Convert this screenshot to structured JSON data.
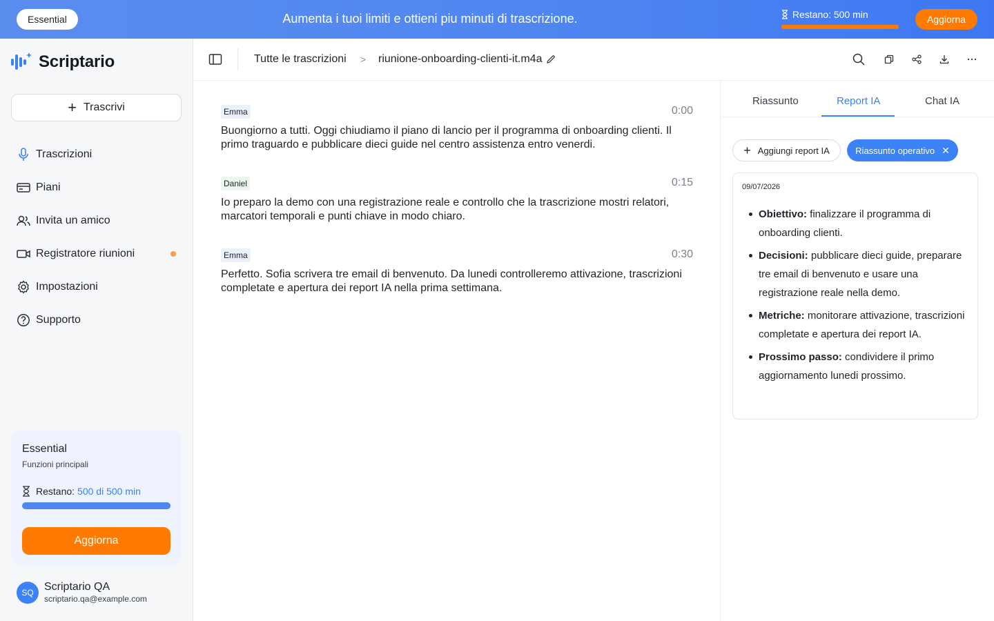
{
  "banner": {
    "plan": "Essential",
    "message": "Aumenta i tuoi limiti e ottieni piu minuti di trascrizione.",
    "remaining_label": "Restano:",
    "remaining_value": "500 min",
    "remaining_fraction": 1.0,
    "upgrade_label": "Aggiorna"
  },
  "sidebar": {
    "logo_text": "Scriptario",
    "transcribe_label": "Trascrivi",
    "items": [
      {
        "label": "Trascrizioni",
        "icon": "microphone-icon",
        "active": true
      },
      {
        "label": "Piani",
        "icon": "credit-card-icon"
      },
      {
        "label": "Invita un amico",
        "icon": "users-icon"
      },
      {
        "label": "Registratore riunioni",
        "icon": "video-camera-icon",
        "dot": true
      },
      {
        "label": "Impostazioni",
        "icon": "gear-icon"
      },
      {
        "label": "Supporto",
        "icon": "help-circle-icon"
      }
    ],
    "plan_card": {
      "name": "Essential",
      "subtitle": "Funzioni principali",
      "remaining_label": "Restano:",
      "remaining_value": "500 di 500 min",
      "remaining_fraction": 1.0,
      "upgrade_label": "Aggiorna"
    },
    "user": {
      "initials": "SQ",
      "name": "Scriptario QA",
      "email": "scriptario.qa@example.com"
    }
  },
  "topbar": {
    "breadcrumb_root": "Tutte le trascrizioni",
    "breadcrumb_sep": ">",
    "file_name": "riunione-onboarding-clienti-it.m4a",
    "actions": [
      "search-icon",
      "copy-icon",
      "share-icon",
      "download-icon",
      "more-icon"
    ]
  },
  "transcript": [
    {
      "speaker": "Emma",
      "time": "0:00",
      "text": "Buongiorno a tutti. Oggi chiudiamo il piano di lancio per il programma di onboarding clienti. Il primo traguardo e pubblicare dieci guide nel centro assistenza entro venerdi."
    },
    {
      "speaker": "Daniel",
      "time": "0:15",
      "text": "Io preparo la demo con una registrazione reale e controllo che la trascrizione mostri relatori, marcatori temporali e punti chiave in modo chiaro."
    },
    {
      "speaker": "Emma",
      "time": "0:30",
      "text": "Perfetto. Sofia scrivera tre email di benvenuto. Da lunedi controlleremo attivazione, trascrizioni completate e apertura dei report IA nella prima settimana."
    }
  ],
  "panel": {
    "tabs": [
      "Riassunto",
      "Report IA",
      "Chat IA"
    ],
    "active_tab": "Report IA",
    "add_report_label": "Aggiungi report IA",
    "active_chip_label": "Riassunto operativo",
    "report": {
      "date": "09/07/2026",
      "items": [
        {
          "title": "Obiettivo:",
          "text": " finalizzare il programma di onboarding clienti."
        },
        {
          "title": "Decisioni:",
          "text": " pubblicare dieci guide, preparare tre email di benvenuto e usare una registrazione reale nella demo."
        },
        {
          "title": "Metriche:",
          "text": " monitorare attivazione, trascrizioni completate e apertura dei report IA."
        },
        {
          "title": "Prossimo passo:",
          "text": " condividere il primo aggiornamento lunedi prossimo."
        }
      ]
    }
  },
  "colors": {
    "accent": "#3b82f6",
    "upgrade": "#ff7a00",
    "banner_start": "#5b8def",
    "banner_end": "#3d78f2"
  }
}
